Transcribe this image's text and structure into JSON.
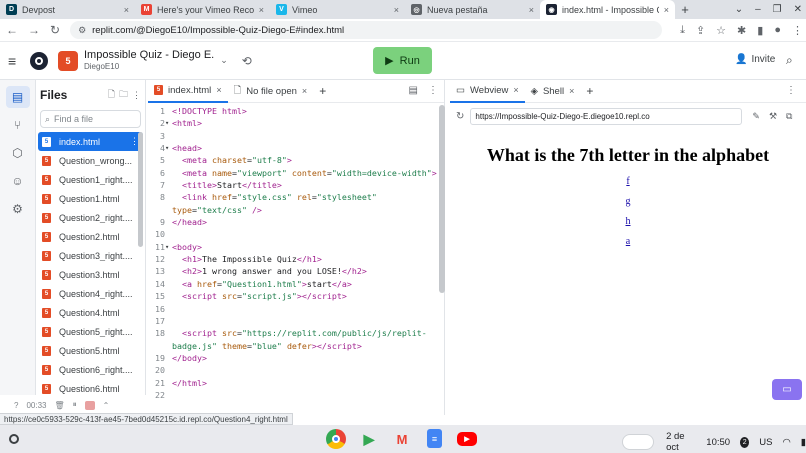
{
  "browser": {
    "tabs": [
      {
        "title": "Devpost",
        "fav_color": "#003e54",
        "fav_glyph": "D",
        "active": false
      },
      {
        "title": "Here's your Vimeo Record insi",
        "fav_color": "#ea4335",
        "fav_glyph": "M",
        "active": false
      },
      {
        "title": "Vimeo",
        "fav_color": "#1ab7ea",
        "fav_glyph": "V",
        "active": false
      },
      {
        "title": "Nueva pestaña",
        "fav_color": "#5f6368",
        "fav_glyph": "◎",
        "active": false
      },
      {
        "title": "index.html - Impossible Q",
        "fav_color": "#1c2333",
        "fav_glyph": "◉",
        "active": true
      }
    ],
    "new_tab": "+",
    "url": "replit.com/@DiegoE10/Impossible-Quiz-Diego-E#index.html",
    "status_url": "https://ce0c5933-529c-413f-ae45-7bed0d45215c.id.repl.co/Question4_right.html"
  },
  "replit": {
    "project_name": "Impossible Quiz - Diego E.",
    "username": "DiegoE10",
    "run_label": "Run",
    "invite_label": "Invite",
    "files_title": "Files",
    "find_placeholder": "Find a file",
    "files": [
      "index.html",
      "Question_wrong...",
      "Question1_right....",
      "Question1.html",
      "Question2_right....",
      "Question2.html",
      "Question3_right....",
      "Question3.html",
      "Question4_right....",
      "Question4.html",
      "Question5_right....",
      "Question5.html",
      "Question6_right....",
      "Question6.html"
    ],
    "active_file_index": 0,
    "bottom_bar": {
      "time": "00:33",
      "labels": [
        "?",
        "Recent",
        "Settings"
      ]
    }
  },
  "editor": {
    "tabs": [
      {
        "label": "index.html",
        "active": true
      },
      {
        "label": "No file open",
        "active": false
      }
    ],
    "lines": [
      {
        "n": "1",
        "fold": "",
        "html": "<span class='tg'>&lt;!DOCTYPE html&gt;</span>"
      },
      {
        "n": "2",
        "fold": "▾",
        "html": "<span class='tg'>&lt;html&gt;</span>"
      },
      {
        "n": "3",
        "fold": "",
        "html": ""
      },
      {
        "n": "4",
        "fold": "▾",
        "html": "<span class='tg'>&lt;head&gt;</span>"
      },
      {
        "n": "5",
        "fold": "",
        "html": "  <span class='tg'>&lt;meta</span> <span class='at'>charset</span>=<span class='st'>\"utf-8\"</span><span class='tg'>&gt;</span>"
      },
      {
        "n": "6",
        "fold": "",
        "html": "  <span class='tg'>&lt;meta</span> <span class='at'>name</span>=<span class='st'>\"viewport\"</span> <span class='at'>content</span>=<span class='st'>\"width=device-width\"</span><span class='tg'>&gt;</span>"
      },
      {
        "n": "7",
        "fold": "",
        "html": "  <span class='tg'>&lt;title&gt;</span>Start<span class='tg'>&lt;/title&gt;</span>"
      },
      {
        "n": "8",
        "fold": "",
        "html": "  <span class='tg'>&lt;link</span> <span class='at'>href</span>=<span class='st'>\"style.css\"</span> <span class='at'>rel</span>=<span class='st'>\"stylesheet\"</span>"
      },
      {
        "n": "",
        "fold": "",
        "html": "<span class='at'>type</span>=<span class='st'>\"text/css\"</span> <span class='tg'>/&gt;</span>"
      },
      {
        "n": "9",
        "fold": "",
        "html": "<span class='tg'>&lt;/head&gt;</span>"
      },
      {
        "n": "10",
        "fold": "",
        "html": ""
      },
      {
        "n": "11",
        "fold": "▾",
        "html": "<span class='tg'>&lt;body&gt;</span>"
      },
      {
        "n": "12",
        "fold": "",
        "html": "  <span class='tg'>&lt;h1&gt;</span>The Impossible Quiz<span class='tg'>&lt;/h1&gt;</span>"
      },
      {
        "n": "13",
        "fold": "",
        "html": "  <span class='tg'>&lt;h2&gt;</span>1 wrong answer and you LOSE!<span class='tg'>&lt;/h2&gt;</span>"
      },
      {
        "n": "14",
        "fold": "",
        "html": "  <span class='tg'>&lt;a</span> <span class='at'>href</span>=<span class='st'>\"Question1.html\"</span><span class='tg'>&gt;</span>start<span class='tg'>&lt;/a&gt;</span>"
      },
      {
        "n": "15",
        "fold": "",
        "html": "  <span class='tg'>&lt;script</span> <span class='at'>src</span>=<span class='st'>\"script.js\"</span><span class='tg'>&gt;&lt;/script&gt;</span>"
      },
      {
        "n": "16",
        "fold": "",
        "html": ""
      },
      {
        "n": "17",
        "fold": "",
        "html": ""
      },
      {
        "n": "18",
        "fold": "",
        "html": "  <span class='tg'>&lt;script</span> <span class='at'>src</span>=<span class='st'>\"https://replit.com/public/js/replit-</span>"
      },
      {
        "n": "",
        "fold": "",
        "html": "<span class='st'>badge.js\"</span> <span class='at'>theme</span>=<span class='st'>\"blue\"</span> <span class='at'>defer</span><span class='tg'>&gt;&lt;/script&gt;</span>"
      },
      {
        "n": "19",
        "fold": "",
        "html": "<span class='tg'>&lt;/body&gt;</span>"
      },
      {
        "n": "20",
        "fold": "",
        "html": ""
      },
      {
        "n": "21",
        "fold": "",
        "html": "<span class='tg'>&lt;/html&gt;</span>"
      },
      {
        "n": "22",
        "fold": "",
        "html": ""
      }
    ]
  },
  "webview": {
    "tabs": [
      {
        "label": "Webview",
        "active": true
      },
      {
        "label": "Shell",
        "active": false
      }
    ],
    "url": "https://Impossible-Quiz-Diego-E.diegoe10.repl.co",
    "heading": "What is the 7th letter in the alphabet",
    "options": [
      "f",
      "g",
      "h",
      "a"
    ]
  },
  "shelf": {
    "date": "2 de oct",
    "time": "10:50",
    "badge": "2",
    "locale": "US"
  }
}
